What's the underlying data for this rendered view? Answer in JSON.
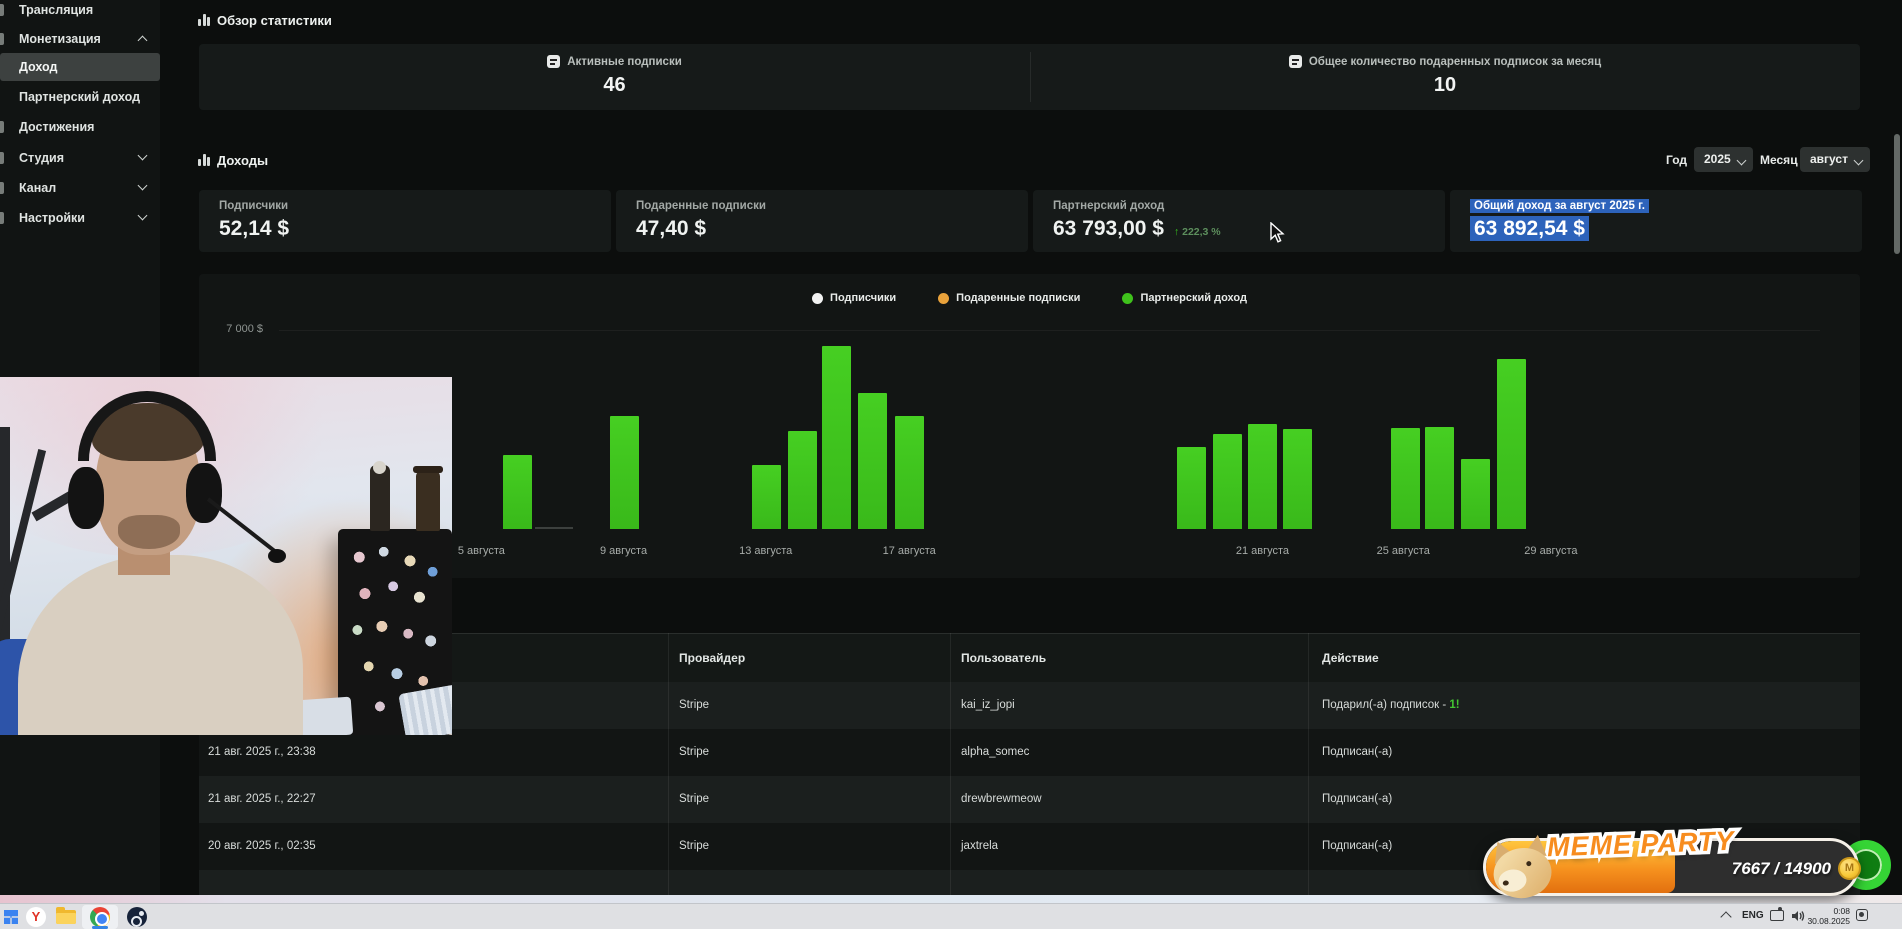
{
  "sidebar": {
    "items": [
      {
        "label": "Трансляция"
      },
      {
        "label": "Монетизация",
        "chevron": "up"
      },
      {
        "label": "Доход",
        "selected": true
      },
      {
        "label": "Партнерский доход"
      },
      {
        "label": "Достижения"
      },
      {
        "label": "Студия",
        "chevron": "down"
      },
      {
        "label": "Канал",
        "chevron": "down"
      },
      {
        "label": "Настройки",
        "chevron": "down"
      }
    ]
  },
  "overview": {
    "title": "Обзор статистики",
    "stats": [
      {
        "label": "Активные подписки",
        "value": "46"
      },
      {
        "label": "Общее количество подаренных подписок за месяц",
        "value": "10"
      }
    ]
  },
  "income": {
    "title": "Доходы",
    "filters": {
      "year_label": "Год",
      "year_value": "2025",
      "month_label": "Месяц",
      "month_value": "август"
    },
    "cards": [
      {
        "label": "Подписчики",
        "value": "52,14 $"
      },
      {
        "label": "Подаренные подписки",
        "value": "47,40 $"
      },
      {
        "label": "Партнерский доход",
        "value": "63 793,00 $",
        "delta_arrow": "↑",
        "delta": "222,3 %"
      },
      {
        "label": "Общий доход за август 2025 г.",
        "value": "63 892,54 $",
        "selected": true
      }
    ]
  },
  "chart_data": {
    "type": "bar",
    "title": "",
    "legend": [
      {
        "name": "Подписчики",
        "color": "#f2f2f2"
      },
      {
        "name": "Подаренные подписки",
        "color": "#e9a23b"
      },
      {
        "name": "Партнерский доход",
        "color": "#3fc21c"
      }
    ],
    "visible_series": "Партнерский доход",
    "y_axis": {
      "visible_tick_label": "7 000 $",
      "min": 0,
      "max": 7000,
      "unit": "$"
    },
    "grid": false,
    "x_ticks": [
      {
        "label": "5 августа",
        "x_frac": 0.03
      },
      {
        "label": "9 августа",
        "x_frac": 0.133
      },
      {
        "label": "13 августа",
        "x_frac": 0.236
      },
      {
        "label": "17 августа",
        "x_frac": 0.34
      },
      {
        "label": "21 августа",
        "x_frac": 0.596
      },
      {
        "label": "25 августа",
        "x_frac": 0.698
      },
      {
        "label": "29 августа",
        "x_frac": 0.805
      }
    ],
    "bars": [
      {
        "x_frac": 0.056,
        "value": 2600
      },
      {
        "x_frac": 0.133,
        "value": 3980
      },
      {
        "x_frac": 0.236,
        "value": 2250
      },
      {
        "x_frac": 0.262,
        "value": 3450
      },
      {
        "x_frac": 0.287,
        "value": 6440
      },
      {
        "x_frac": 0.313,
        "value": 4790
      },
      {
        "x_frac": 0.34,
        "value": 3980
      },
      {
        "x_frac": 0.544,
        "value": 2880
      },
      {
        "x_frac": 0.57,
        "value": 3340
      },
      {
        "x_frac": 0.596,
        "value": 3690
      },
      {
        "x_frac": 0.621,
        "value": 3520
      },
      {
        "x_frac": 0.699,
        "value": 3550
      },
      {
        "x_frac": 0.724,
        "value": 3590
      },
      {
        "x_frac": 0.75,
        "value": 2460
      },
      {
        "x_frac": 0.776,
        "value": 5980
      }
    ],
    "bar_color": "#3fc21c"
  },
  "table": {
    "headers": [
      "",
      "Провайдер",
      "Пользователь",
      "Действие"
    ],
    "rows": [
      {
        "date": "",
        "provider": "Stripe",
        "user": "kai_iz_jopi",
        "action": "Подарил(-а) подписок - ",
        "action_highlight": "1!"
      },
      {
        "date": "21 авг. 2025 г., 23:38",
        "provider": "Stripe",
        "user": "alpha_somec",
        "action": "Подписан(-а)",
        "action_highlight": ""
      },
      {
        "date": "21 авг. 2025 г., 22:27",
        "provider": "Stripe",
        "user": "drewbrewmeow",
        "action": "Подписан(-а)",
        "action_highlight": ""
      },
      {
        "date": "20 авг. 2025 г., 02:35",
        "provider": "Stripe",
        "user": "jaxtrela",
        "action": "Подписан(-а)",
        "action_highlight": ""
      },
      {
        "date": "",
        "provider": "",
        "user": "",
        "action": "",
        "action_highlight": ""
      }
    ]
  },
  "meme_party": {
    "title": "MEME PARTY",
    "progress_text": "7667 / 14900",
    "current": 7667,
    "max": 14900,
    "coin_letter": "M"
  },
  "taskbar": {
    "icons": [
      "start",
      "yandex-browser",
      "file-explorer",
      "chrome",
      "steam"
    ],
    "active_icon": "chrome",
    "tray": {
      "lang": "ENG",
      "time": "0:08",
      "date": "30.08.2025"
    }
  },
  "colors": {
    "accent_green": "#3fc21c",
    "legend_orange": "#e9a23b",
    "selection_blue": "#2d63bb",
    "page_bg": "#0c0e0d",
    "card_bg": "#161a19",
    "taskbar_bg": "#dfe0e3"
  }
}
